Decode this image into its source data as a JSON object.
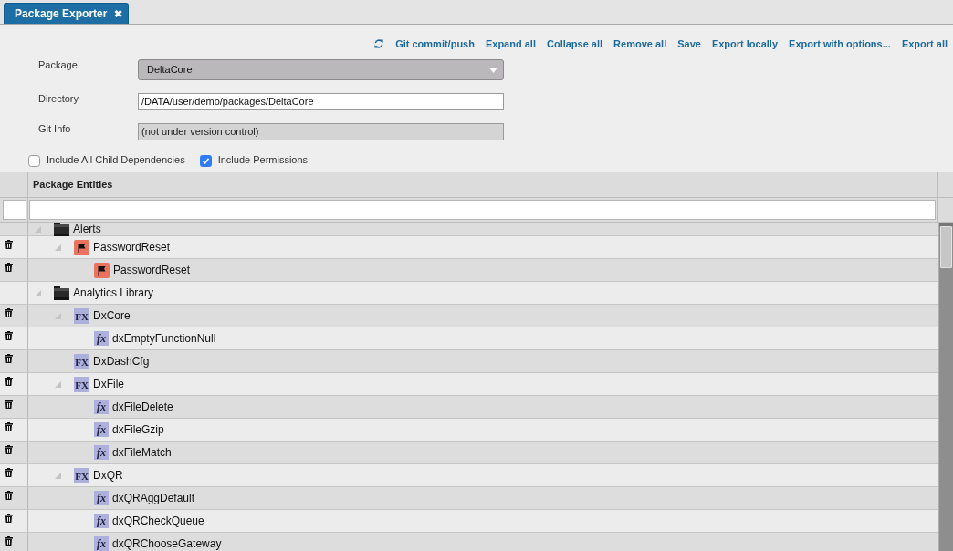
{
  "tab": {
    "label": "Package Exporter",
    "close": "✖",
    "selected": true
  },
  "toolbar": {
    "actions": [
      "Git commit/push",
      "Expand all",
      "Collapse all",
      "Remove all",
      "Save",
      "Export locally",
      "Export with options...",
      "Export all"
    ]
  },
  "form": {
    "package": {
      "label": "Package",
      "value": "DeltaCore"
    },
    "directory": {
      "label": "Directory",
      "value": "/DATA/user/demo/packages/DeltaCore"
    },
    "git_info": {
      "label": "Git Info",
      "value": "(not under version control)",
      "disabled": true
    }
  },
  "options": [
    {
      "label": "Include All Child Dependencies",
      "checked": false
    },
    {
      "label": "Include Permissions",
      "checked": true
    }
  ],
  "table": {
    "header": "Package Entities"
  },
  "tree": [
    {
      "label": "Alerts",
      "kind": "folder",
      "expanded": true,
      "children": [
        {
          "label": "PasswordReset",
          "kind": "flag_group",
          "expanded": true,
          "children": [
            {
              "label": "PasswordReset",
              "kind": "flag"
            }
          ]
        }
      ]
    },
    {
      "label": "Analytics Library",
      "kind": "folder",
      "expanded": true,
      "children": [
        {
          "label": "DxCore",
          "kind": "function_group",
          "icon": "FX",
          "expanded": true,
          "children": [
            {
              "label": "dxEmptyFunctionNull",
              "kind": "function",
              "icon": "fx"
            }
          ]
        },
        {
          "label": "DxDashCfg",
          "kind": "function_group",
          "icon": "FX"
        },
        {
          "label": "DxFile",
          "kind": "function_group",
          "icon": "FX",
          "expanded": true,
          "children": [
            {
              "label": "dxFileDelete",
              "kind": "function",
              "icon": "fx"
            },
            {
              "label": "dxFileGzip",
              "kind": "function",
              "icon": "fx"
            },
            {
              "label": "dxFileMatch",
              "kind": "function",
              "icon": "fx"
            }
          ]
        },
        {
          "label": "DxQR",
          "kind": "function_group",
          "icon": "FX",
          "expanded": true,
          "children": [
            {
              "label": "dxQRAggDefault",
              "kind": "function",
              "icon": "fx"
            },
            {
              "label": "dxQRCheckQueue",
              "kind": "function",
              "icon": "fx"
            },
            {
              "label": "dxQRChooseGateway",
              "kind": "function",
              "icon": "fx"
            }
          ]
        }
      ]
    }
  ]
}
